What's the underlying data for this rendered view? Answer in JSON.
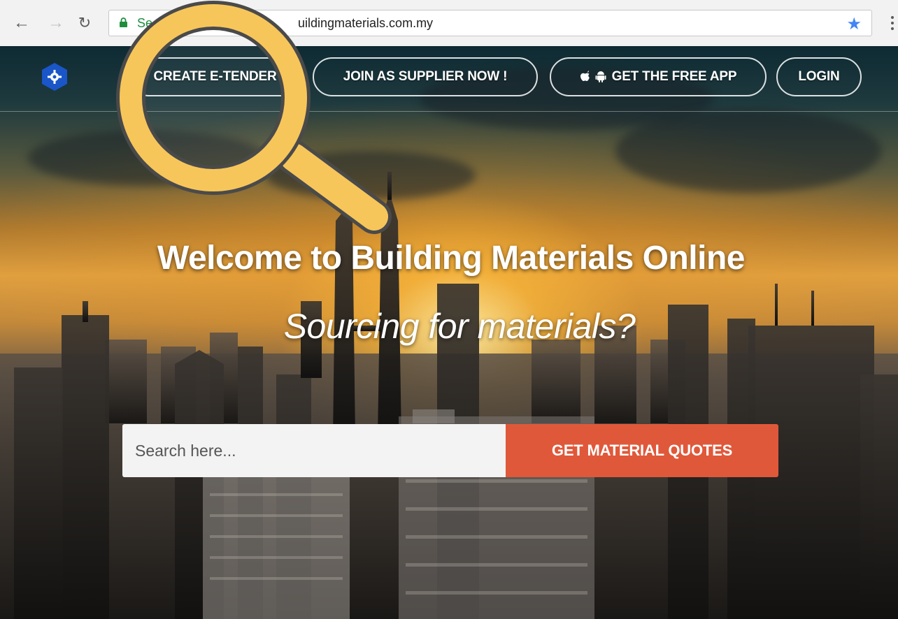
{
  "browser": {
    "back_icon": "arrow-left-icon",
    "forward_icon": "arrow-right-icon",
    "reload_icon": "reload-icon",
    "address_secure_text": "Se",
    "address_url": "uildingmaterials.com.my",
    "bookmark_icon": "star-icon",
    "menu_icon": "kebab-menu-icon",
    "secure_color": "#1e8e3e",
    "star_color": "#4285f4"
  },
  "header": {
    "logo_icon": "hexagon-gear-logo",
    "nav": [
      {
        "label": "CREATE E-TENDER"
      },
      {
        "label": "JOIN AS SUPPLIER NOW !"
      },
      {
        "label": "GET THE FREE APP",
        "icons": [
          "apple-icon",
          "android-icon"
        ]
      },
      {
        "label": "LOGIN"
      }
    ]
  },
  "hero": {
    "title": "Welcome to Building Materials Online",
    "subtitle": "Sourcing for materials?",
    "search_placeholder": "Search here...",
    "cta_label": "GET MATERIAL QUOTES",
    "cta_color": "#e0583a"
  },
  "overlay": {
    "magnifier_icon": "magnifying-glass-icon",
    "magnifier_color": "#f7c65a"
  }
}
